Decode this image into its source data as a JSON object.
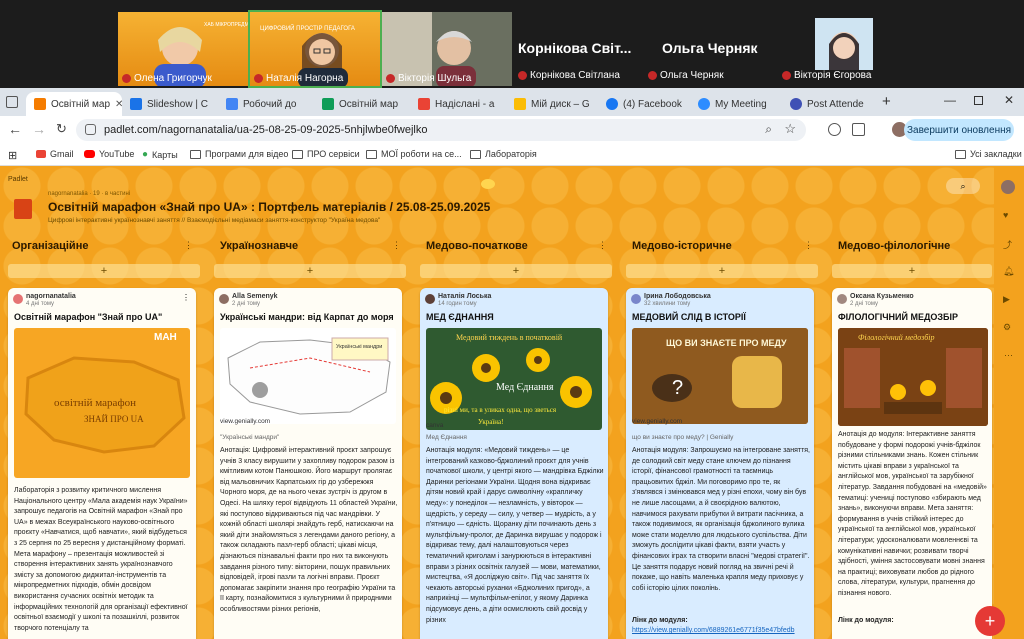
{
  "meeting": {
    "participants": [
      {
        "name": "Олена Григорчук"
      },
      {
        "name": "Наталія Нагорна"
      },
      {
        "name": "Вікторія Шульга"
      },
      {
        "name": "Корнікова Світлана",
        "display": "Корнікова Світ..."
      },
      {
        "name": "Ольга Черняк",
        "display": "Ольга Черняк"
      },
      {
        "name": "Вікторія Єгорова"
      }
    ],
    "slide_text": "ХАБ ЦИФРОВИЙ ПРОСТІР ПЕДАГОГА",
    "slide_text2": "ЦИФРОВИЙ ПРОСТІР ПЕДАГОГА"
  },
  "browser": {
    "tabs": [
      {
        "label": "Освітній мар",
        "color": "#f57c00"
      },
      {
        "label": "Slideshow | C",
        "color": "#1a73e8"
      },
      {
        "label": "Робочий до",
        "color": "#4285f4"
      },
      {
        "label": "Освітній мар",
        "color": "#0f9d58"
      },
      {
        "label": "Надіслані - а",
        "color": "#ea4335"
      },
      {
        "label": "Мій диск – G",
        "color": "#fbbc04"
      },
      {
        "label": "(4) Facebook",
        "color": "#1877f2"
      },
      {
        "label": "My Meeting",
        "color": "#2d8cff"
      },
      {
        "label": "Post Attende",
        "color": "#3f51b5"
      }
    ],
    "url": "padlet.com/nagornanatalia/ua-25-08-25-09-2025-5nhjlwbe0fwejlko",
    "update_label": "Завершити оновлення",
    "bookmarks": [
      "Gmail",
      "YouTube",
      "Карты",
      "Програми для відео",
      "ПРО сервіси",
      "МОЇ роботи на се...",
      "Лабораторія"
    ],
    "all_bookmarks": "Усі закладки"
  },
  "padlet": {
    "brand": "Padlet",
    "meta": "nagornanatalia · 19 · в частині",
    "title": "Освітній марафон «Знай про UA» : Портфель матеріалів / 25.08-25.09.2025",
    "subtitle": "Цифрові інтерактивні українознавчі заняття // Взаємодієльні медіамаси заняття-конструктор \"Україна медова\"",
    "columns": [
      {
        "title": "Організаційне"
      },
      {
        "title": "Українознавче"
      },
      {
        "title": "Медово-початкове"
      },
      {
        "title": "Медово-історичне"
      },
      {
        "title": "Медово-філологічне"
      }
    ],
    "cards": [
      {
        "author": "nagornanatalia",
        "ago": "4 дні тому",
        "title": "Освітній марафон \"Знай про UA\"",
        "image_text": "освітній марафон ЗНАЙ ПРО UA",
        "body": "Лабораторія з розвитку критичного мислення Національного центру «Мала академія наук України» запрошує педагогів на Освітній марафон «Знай про UA» в межах Всеукраїнського науково-освітнього проєкту «Навчатися, щоб навчати», який відбудеться з 25 серпня по 25 вересня у дистанційному форматі. Мета марафону – презентація можливостей зі створення інтерактивних занять українознавчого змісту за допомогою диджитал-інструментів та мікропредметних підходів, обмін досвідом використання сучасних освітніх методик та інформаційних технологій для організації ефективної освітньої взаємодії у школі та позашкіллі, розвиток творчого потенціалу та"
      },
      {
        "author": "Alla Semenyk",
        "ago": "2 дні тому",
        "title": "Українські мандри: від Карпат до моря",
        "image_text": "Українські мандри: від Карпат до моря",
        "link": "view.genially.com",
        "caption": "\"Українські мандри\"",
        "body": "Анотація: Цифровий інтерактивний проєкт запрошує учнів 3 класу вирушити у захопливу подорож разом із кмітливим котом Панюшкою. Його маршрут пролягає від мальовничих Карпатських гір до узбережжя Чорного моря, де на нього чекає зустріч із другом в Одесі. На шляху герої відвідують 11 областей України, які поступово відкриваються під час мандрівки. У кожній області школярі знайдуть герб, натискаючи на який діти знайомляться з легендами даного регіону, а також складають пазл-герб області; цікаві місця, дізнаються пізнавальні факти про них та виконують завдання різного типу: вікторини, пошук правильних відповідей, ігрові пазли та логічні вправи. Проєкт допомагає закріпити знання про географію України та її карту, познайомитися з культурними й природними особливостями різних регіонів,"
      },
      {
        "author": "Наталія Лоська",
        "ago": "14 годин тому",
        "title": "МЕД ЄДНАННЯ",
        "image_text": "Медовий тиждень в початковій школі · Мед єднання різні ми, та в уликах одна, що зветься Україна!",
        "link": "canva",
        "caption": "Мед Єднання",
        "body": "Анотація модуля: «Медовий тиждень» — це інтегрований казково-бджолиний проєкт для учнів початкової школи, у центрі якого — мандрівка Бджілки Даринки регіонами України. Щодня вона відкриває дітям новий край і дарує символічну «крапличку меду»: у понеділок — незламність, у вівторок — щедрість, у середу — силу, у четвер — мудрість, а у п'ятницю — єдність. Щоранку діти починають день з мультфільму-пролог, де Даринка вирушає у подорож і відкриває тему, далі налаштовуються через тематичний криголам і занурюються в інтерактивні вправи з різних освітніх галузей — мови, математики, мистецтва, «Я досліджую світ». Під час заняття їх чекають авторські руханки «Бджолиних пригод», а наприкінці — мультфільм-епілог, у якому Даринка підсумовує день, а діти осмислюють свій досвід у різних"
      },
      {
        "author": "Ірина Лободовська",
        "ago": "32 хвилини тому",
        "title": "МЕДОВИЙ СЛІД В ІСТОРІЇ",
        "image_text": "ЩО ВИ ЗНАЄТЕ ПРО МЕДУ",
        "link": "view.genially.com",
        "caption": "що ви знаєте про меду? | Genially",
        "body": "Анотація модуля: Запрошуємо на інтегроване заняття, де солодкий світ меду стане ключем до пізнання історії, фінансової грамотності та таємниць працьовитих бджіл. Ми поговоримо про те, як з'являвся і змінювався мед у різні епохи, чому він був не лише ласощами, а й своєрідною валютою, навчимося рахувати прибутки й витрати пасічника, а також подивимося, як організація бджолиного вулика може стати моделлю для людського суспільства. Діти зможуть дослідити цікаві факти, взяти участь у фінансових іграх та створити власні \"медові стратегії\". Це заняття подарує новий погляд на звичні речі й покаже, що навіть маленька крапля меду приховує у собі історію цілих поколінь.",
        "link_label": "Лінк до модуля:",
        "link_url": "https://view.genially.com/6889261e6771f35e47bfedb"
      },
      {
        "author": "Оксана Кузьменко",
        "ago": "2 дні тому",
        "title": "ФІЛОЛОГІЧНИЙ МЕДОЗБІР",
        "image_text": "Філологічний медозбір",
        "body": "Анотація до модуля: Інтерактивне заняття побудоване у формі подорожі учнів-бджілок різними стільниками знань. Кожен стільник містить цікаві вправи з української та англійської мов, української та зарубіжної літератур. Завдання побудовані на «медовій» тематиці: учениці поступово «збирають мед знань», виконуючи вправи. Мета заняття: формування в учнів стійкий інтерес до української та англійської мов, української літератури; удосконалювати мовленнєві та комунікативні навички; розвивати творчі здібності, уміння застосовувати мовні знання на практиці; виховувати любов до рідного слова, літератури, культури, прагнення до пізнання нового.",
        "link_label": "Лінк до модуля:"
      }
    ],
    "search_placeholder": ""
  },
  "colors": {
    "padlet_bg": "#f3a21e",
    "card_blue": "#d9ecff",
    "fab": "#e53935"
  }
}
